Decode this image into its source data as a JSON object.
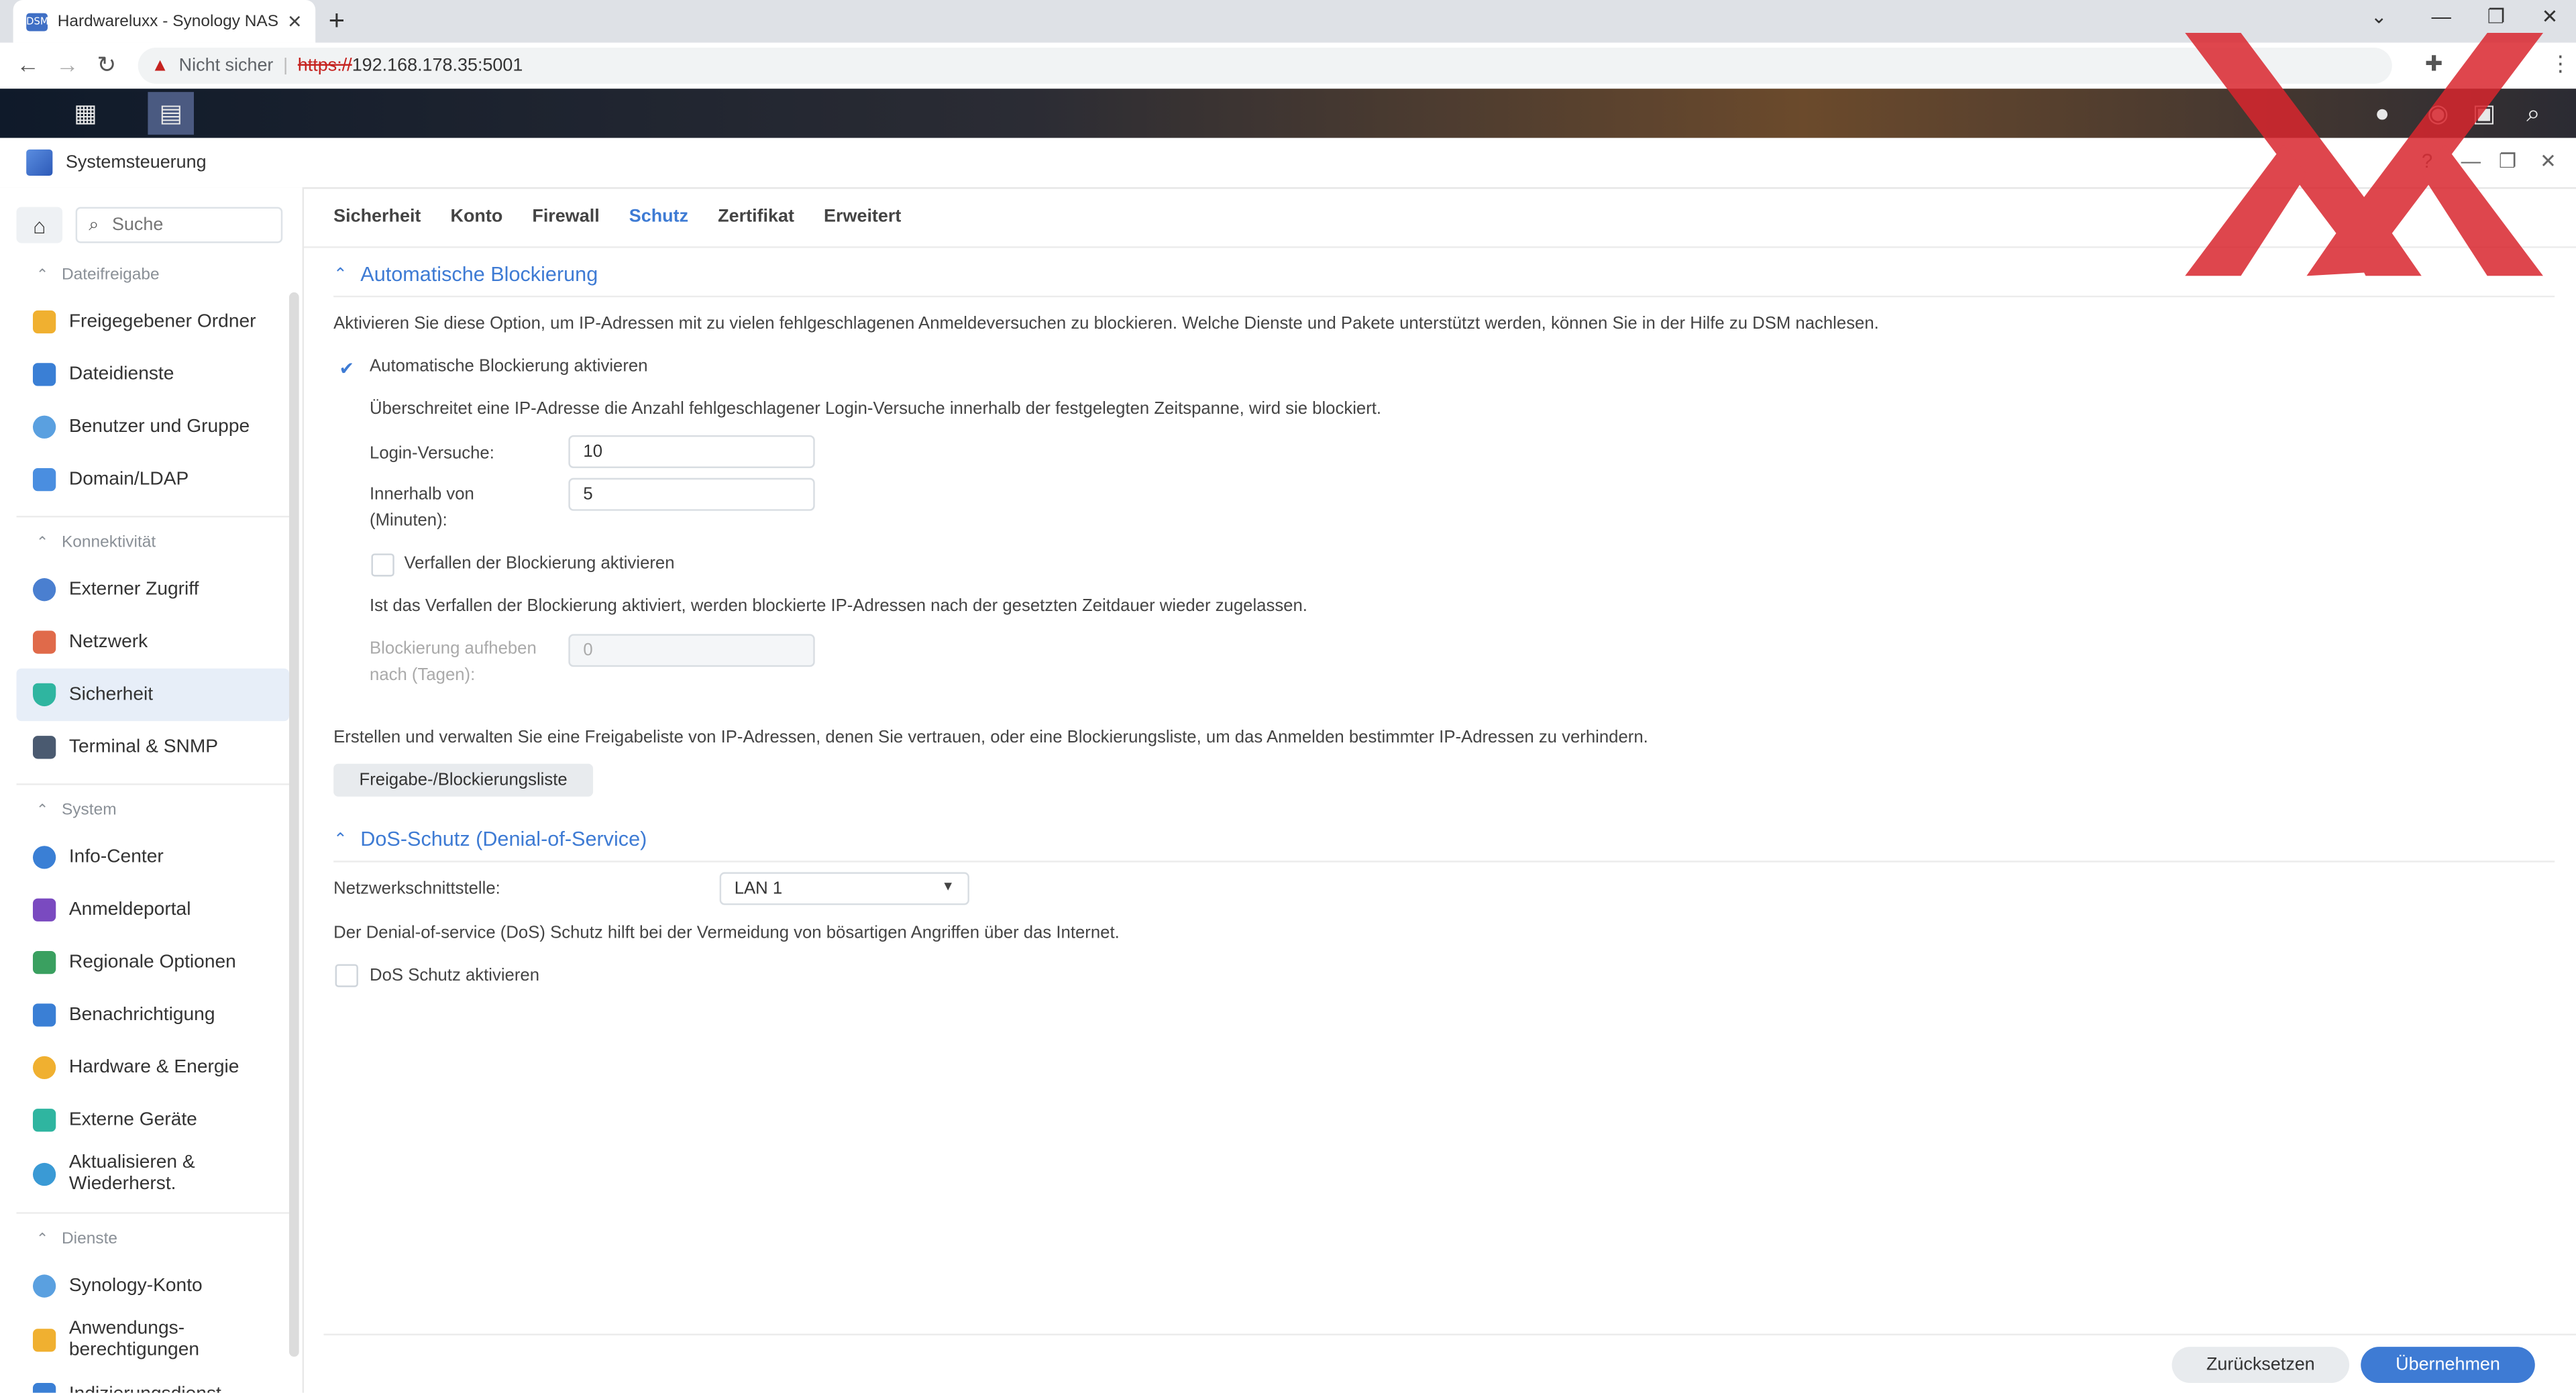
{
  "browser": {
    "tab_title": "Hardwareluxx - Synology NAS",
    "favicon_text": "DSM",
    "url_insecure_label": "Nicht sicher",
    "url_scheme": "https://",
    "url_host": "192.168.178.35:5001"
  },
  "window": {
    "title": "Systemsteuerung"
  },
  "sidebar": {
    "search_placeholder": "Suche",
    "categories": {
      "dateifreigabe": "Dateifreigabe",
      "konnektivitaet": "Konnektivität",
      "system": "System",
      "dienste": "Dienste"
    },
    "items": {
      "freigegebener_ordner": "Freigegebener Ordner",
      "dateidienste": "Dateidienste",
      "benutzer_gruppe": "Benutzer und Gruppe",
      "domain_ldap": "Domain/LDAP",
      "externer_zugriff": "Externer Zugriff",
      "netzwerk": "Netzwerk",
      "sicherheit": "Sicherheit",
      "terminal_snmp": "Terminal & SNMP",
      "info_center": "Info-Center",
      "anmeldeportal": "Anmeldeportal",
      "regionale_optionen": "Regionale Optionen",
      "benachrichtigung": "Benachrichtigung",
      "hardware_energie": "Hardware & Energie",
      "externe_geraete": "Externe Geräte",
      "aktualisieren_1": "Aktualisieren &",
      "aktualisieren_2": "Wiederherst.",
      "synology_konto": "Synology-Konto",
      "anwendungs_1": "Anwendungs-",
      "anwendungs_2": "berechtigungen",
      "indizierung": "Indizierungsdienst"
    },
    "colors": {
      "selected_bg": "#e7eef8"
    }
  },
  "tabs": [
    "Sicherheit",
    "Konto",
    "Firewall",
    "Schutz",
    "Zertifikat",
    "Erweitert"
  ],
  "active_tab": "Schutz",
  "auto_block": {
    "header": "Automatische Blockierung",
    "description": "Aktivieren Sie diese Option, um IP-Adressen mit zu vielen fehlgeschlagenen Anmeldeversuchen zu blockieren. Welche Dienste und Pakete unterstützt werden, können Sie in der Hilfe zu DSM nachlesen.",
    "enable_label": "Automatische Blockierung aktivieren",
    "enable_checked": true,
    "threshold_text": "Überschreitet eine IP-Adresse die Anzahl fehlgeschlagener Login-Versuche innerhalb der festgelegten Zeitspanne, wird sie blockiert.",
    "login_attempts_label": "Login-Versuche:",
    "login_attempts_value": "10",
    "within_label_1": "Innerhalb von",
    "within_label_2": "(Minuten):",
    "within_value": "5",
    "expire_label": "Verfallen der Blockierung aktivieren",
    "expire_checked": false,
    "expire_text": "Ist das Verfallen der Blockierung aktiviert, werden blockierte IP-Adressen nach der gesetzten Zeitdauer wieder zugelassen.",
    "unblock_label_1": "Blockierung aufheben",
    "unblock_label_2": "nach (Tagen):",
    "unblock_value": "0",
    "list_text": "Erstellen und verwalten Sie eine Freigabeliste von IP-Adressen, denen Sie vertrauen, oder eine Blockierungsliste, um das Anmelden bestimmter IP-Adressen zu verhindern.",
    "list_button": "Freigabe-/Blockierungsliste"
  },
  "dos": {
    "header": "DoS-Schutz (Denial-of-Service)",
    "interface_label": "Netzwerkschnittstelle:",
    "interface_value": "LAN 1",
    "description": "Der Denial-of-service (DoS) Schutz hilft bei der Vermeidung von bösartigen Angriffen über das Internet.",
    "enable_label": "DoS Schutz aktivieren",
    "enable_checked": false
  },
  "footer": {
    "reset": "Zurücksetzen",
    "apply": "Übernehmen"
  },
  "colors": {
    "accent": "#3e7bd4",
    "watermark": "#d9262e"
  }
}
